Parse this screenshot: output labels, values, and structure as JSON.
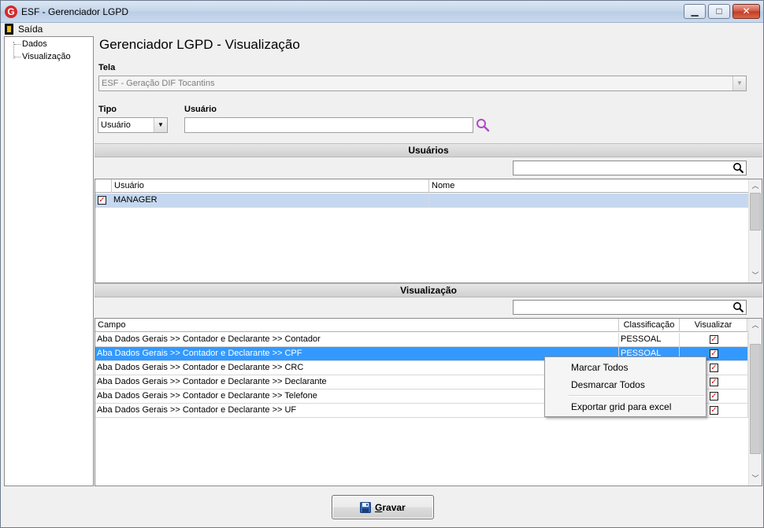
{
  "window": {
    "title": "ESF - Gerenciador LGPD",
    "logo_letter": "G",
    "controls": {
      "minimize": "▁",
      "maximize": "□",
      "close": "✕"
    }
  },
  "menubar": {
    "items": [
      {
        "label": "Saída",
        "icon": "exit-door-icon"
      }
    ]
  },
  "tree": {
    "items": [
      {
        "label": "Dados"
      },
      {
        "label": "Visualização"
      }
    ]
  },
  "page": {
    "title": "Gerenciador LGPD - Visualização",
    "tela_label": "Tela",
    "tela_value": "ESF - Geração DIF Tocantins",
    "tipo_label": "Tipo",
    "tipo_value": "Usuário",
    "usuario_label": "Usuário",
    "usuario_value": ""
  },
  "usuarios_section": {
    "title": "Usuários",
    "search_value": "",
    "columns": [
      "Usuário",
      "Nome"
    ],
    "rows": [
      {
        "checked": true,
        "usuario": "MANAGER",
        "nome": ""
      }
    ]
  },
  "visualizacao_section": {
    "title": "Visualização",
    "search_value": "",
    "columns": [
      "Campo",
      "Classificação",
      "Visualizar"
    ],
    "rows": [
      {
        "campo": "Aba Dados Gerais >> Contador e Declarante >> Contador",
        "classificacao": "PESSOAL",
        "visualizar": true
      },
      {
        "campo": "Aba Dados Gerais >> Contador e Declarante >> CPF",
        "classificacao": "PESSOAL",
        "visualizar": true
      },
      {
        "campo": "Aba Dados Gerais >> Contador e Declarante >> CRC",
        "classificacao": "",
        "visualizar": true
      },
      {
        "campo": "Aba Dados Gerais >> Contador e Declarante >> Declarante",
        "classificacao": "",
        "visualizar": true
      },
      {
        "campo": "Aba Dados Gerais >> Contador e Declarante >> Telefone",
        "classificacao": "",
        "visualizar": true
      },
      {
        "campo": "Aba Dados Gerais >> Contador e Declarante >> UF",
        "classificacao": "",
        "visualizar": true
      }
    ]
  },
  "context_menu": {
    "items": [
      "Marcar Todos",
      "Desmarcar Todos",
      "Exportar grid para excel"
    ]
  },
  "buttons": {
    "gravar_first": "G",
    "gravar_rest": "ravar"
  },
  "colors": {
    "selection": "#3399ff",
    "row_highlight": "#c5d8f0",
    "check": "#d01818"
  }
}
